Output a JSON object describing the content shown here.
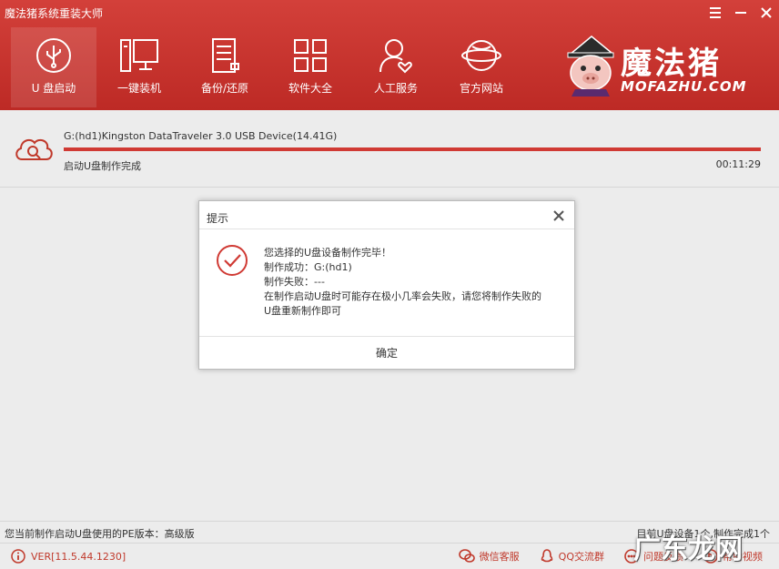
{
  "window": {
    "title": "魔法猪系统重装大师"
  },
  "nav": {
    "items": [
      {
        "label": "U 盘启动",
        "icon": "usb-icon"
      },
      {
        "label": "一键装机",
        "icon": "computer-icon"
      },
      {
        "label": "备份/还原",
        "icon": "backup-icon"
      },
      {
        "label": "软件大全",
        "icon": "apps-grid-icon"
      },
      {
        "label": "人工服务",
        "icon": "user-heart-icon"
      },
      {
        "label": "官方网站",
        "icon": "globe-icon"
      }
    ]
  },
  "logo": {
    "text": "魔法猪",
    "subtext": "MOFAZHU.COM"
  },
  "progress": {
    "device": "G:(hd1)Kingston DataTraveler 3.0 USB Device(14.41G)",
    "status": "启动U盘制作完成",
    "time": "00:11:29",
    "percent": 100
  },
  "dialog": {
    "title": "提示",
    "lines": [
      "您选择的U盘设备制作完毕！",
      "制作成功：G:(hd1)",
      "制作失败：---",
      "在制作启动U盘时可能存在极小几率会失败，请您将制作失败的",
      "U盘重新制作即可"
    ],
    "ok_label": "确定"
  },
  "info_bar": {
    "pe_version": "您当前制作启动U盘使用的PE版本：高级版",
    "device_count": "目前U盘设备1个,制作完成1个"
  },
  "footer": {
    "version": "VER[11.5.44.1230]",
    "links": [
      {
        "label": "微信客服"
      },
      {
        "label": "QQ交流群"
      },
      {
        "label": "问题反馈"
      },
      {
        "label": "帮助视频"
      }
    ]
  },
  "watermark": "广东龙网",
  "colors": {
    "header": "#c8332e",
    "accent": "#c0392b",
    "success": "#d03a34"
  }
}
